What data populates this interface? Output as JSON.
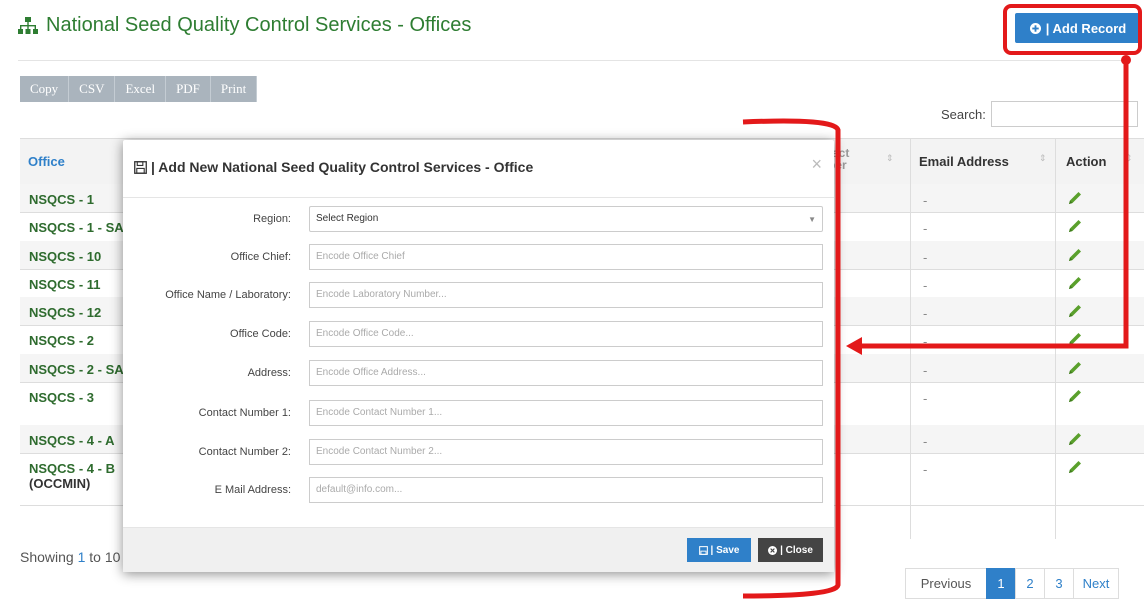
{
  "header": {
    "title": "National Seed Quality Control Services - Offices",
    "add_record_label": "| Add Record"
  },
  "export_buttons": [
    "Copy",
    "CSV",
    "Excel",
    "PDF",
    "Print"
  ],
  "search": {
    "label": "Search:",
    "value": ""
  },
  "table": {
    "columns": {
      "office": "Office",
      "contact": "tact ber",
      "email": "Email Address",
      "action": "Action"
    },
    "rows": [
      {
        "office": "NSQCS - 1",
        "email": "-"
      },
      {
        "office": "NSQCS - 1 - SA",
        "email": "-"
      },
      {
        "office": "NSQCS - 10",
        "email": "-"
      },
      {
        "office": "NSQCS - 11",
        "email": "-"
      },
      {
        "office": "NSQCS - 12",
        "email": "-"
      },
      {
        "office": "NSQCS - 2",
        "email": "-"
      },
      {
        "office": "NSQCS - 2 - SA",
        "email": "-"
      },
      {
        "office": "NSQCS - 3",
        "email": "-"
      },
      {
        "office": "NSQCS - 4 - A",
        "email": "-"
      },
      {
        "office": "NSQCS - 4 - B",
        "office_line2": "(OCCMIN)",
        "email": "-"
      }
    ]
  },
  "footer": {
    "showing_prefix": "Showing ",
    "showing_num": "1",
    "showing_rest": " to 10"
  },
  "pagination": {
    "previous": "Previous",
    "pages": [
      "1",
      "2",
      "3"
    ],
    "active": "1",
    "next": "Next"
  },
  "modal": {
    "title": "| Add New National Seed Quality Control Services - Office",
    "close_glyph": "×",
    "fields": {
      "region": {
        "label": "Region:",
        "value": "Select Region"
      },
      "office_chief": {
        "label": "Office Chief:",
        "placeholder": "Encode Office Chief"
      },
      "office_name": {
        "label": "Office Name / Laboratory:",
        "placeholder": "Encode Laboratory Number..."
      },
      "office_code": {
        "label": "Office Code:",
        "placeholder": "Encode Office Code..."
      },
      "address": {
        "label": "Address:",
        "placeholder": "Encode Office Address..."
      },
      "contact1": {
        "label": "Contact Number 1:",
        "placeholder": "Encode Contact Number 1..."
      },
      "contact2": {
        "label": "Contact Number 2:",
        "placeholder": "Encode Contact Number 2..."
      },
      "email": {
        "label": "E Mail Address:",
        "placeholder": "default@info.com..."
      }
    },
    "save_label": "| Save",
    "close_label": "| Close"
  },
  "colors": {
    "accent": "#2f80c9",
    "title_green": "#2e7d32",
    "annotation_red": "#e3191a"
  }
}
